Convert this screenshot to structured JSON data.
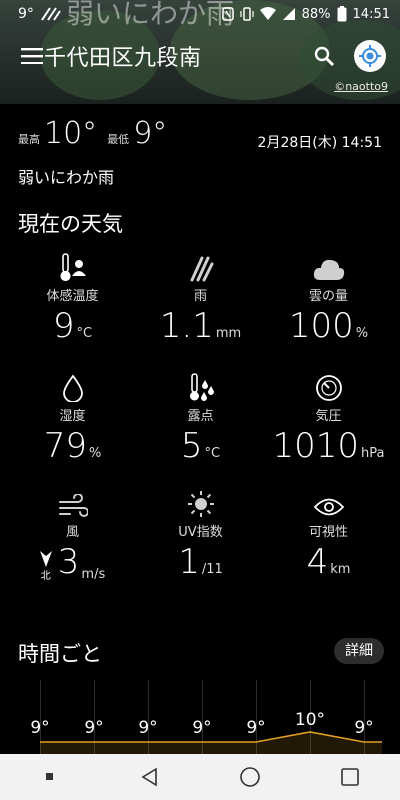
{
  "status": {
    "left_text": "9°",
    "battery": "88%",
    "time": "14:51"
  },
  "header": {
    "background_title": "弱いにわか雨",
    "location": "千代田区九段南",
    "photo_credit": "©naotto9"
  },
  "summary": {
    "high_label": "最高",
    "high": "10°",
    "low_label": "最低",
    "low": "9°",
    "datetime": "2月28日(木) 14:51",
    "condition": "弱いにわか雨"
  },
  "current": {
    "title": "現在の天気",
    "items": [
      {
        "label": "体感温度",
        "value": "9",
        "unit": "°C",
        "icon": "thermometer-person-icon"
      },
      {
        "label": "雨",
        "value": "1.1",
        "unit": "mm",
        "icon": "rain-streaks-icon"
      },
      {
        "label": "雲の量",
        "value": "100",
        "unit": "%",
        "icon": "cloud-icon"
      },
      {
        "label": "湿度",
        "value": "79",
        "unit": "%",
        "icon": "water-drop-icon"
      },
      {
        "label": "露点",
        "value": "5",
        "unit": "°C",
        "icon": "thermometer-drops-icon"
      },
      {
        "label": "気圧",
        "value": "1010",
        "unit": "hPa",
        "icon": "gauge-icon"
      },
      {
        "label": "風",
        "value": "3",
        "unit": "m/s",
        "icon": "wind-icon",
        "direction": "北"
      },
      {
        "label": "UV指数",
        "value": "1",
        "unit": "/11",
        "icon": "sun-icon"
      },
      {
        "label": "可視性",
        "value": "4",
        "unit": "km",
        "icon": "eye-icon"
      }
    ]
  },
  "hourly": {
    "title": "時間ごと",
    "detail_label": "詳細",
    "temps": [
      "9°",
      "9°",
      "9°",
      "9°",
      "9°",
      "10°",
      "9°"
    ]
  },
  "colors": {
    "accent": "#3a8dde",
    "temp_line": "#e0a020"
  }
}
